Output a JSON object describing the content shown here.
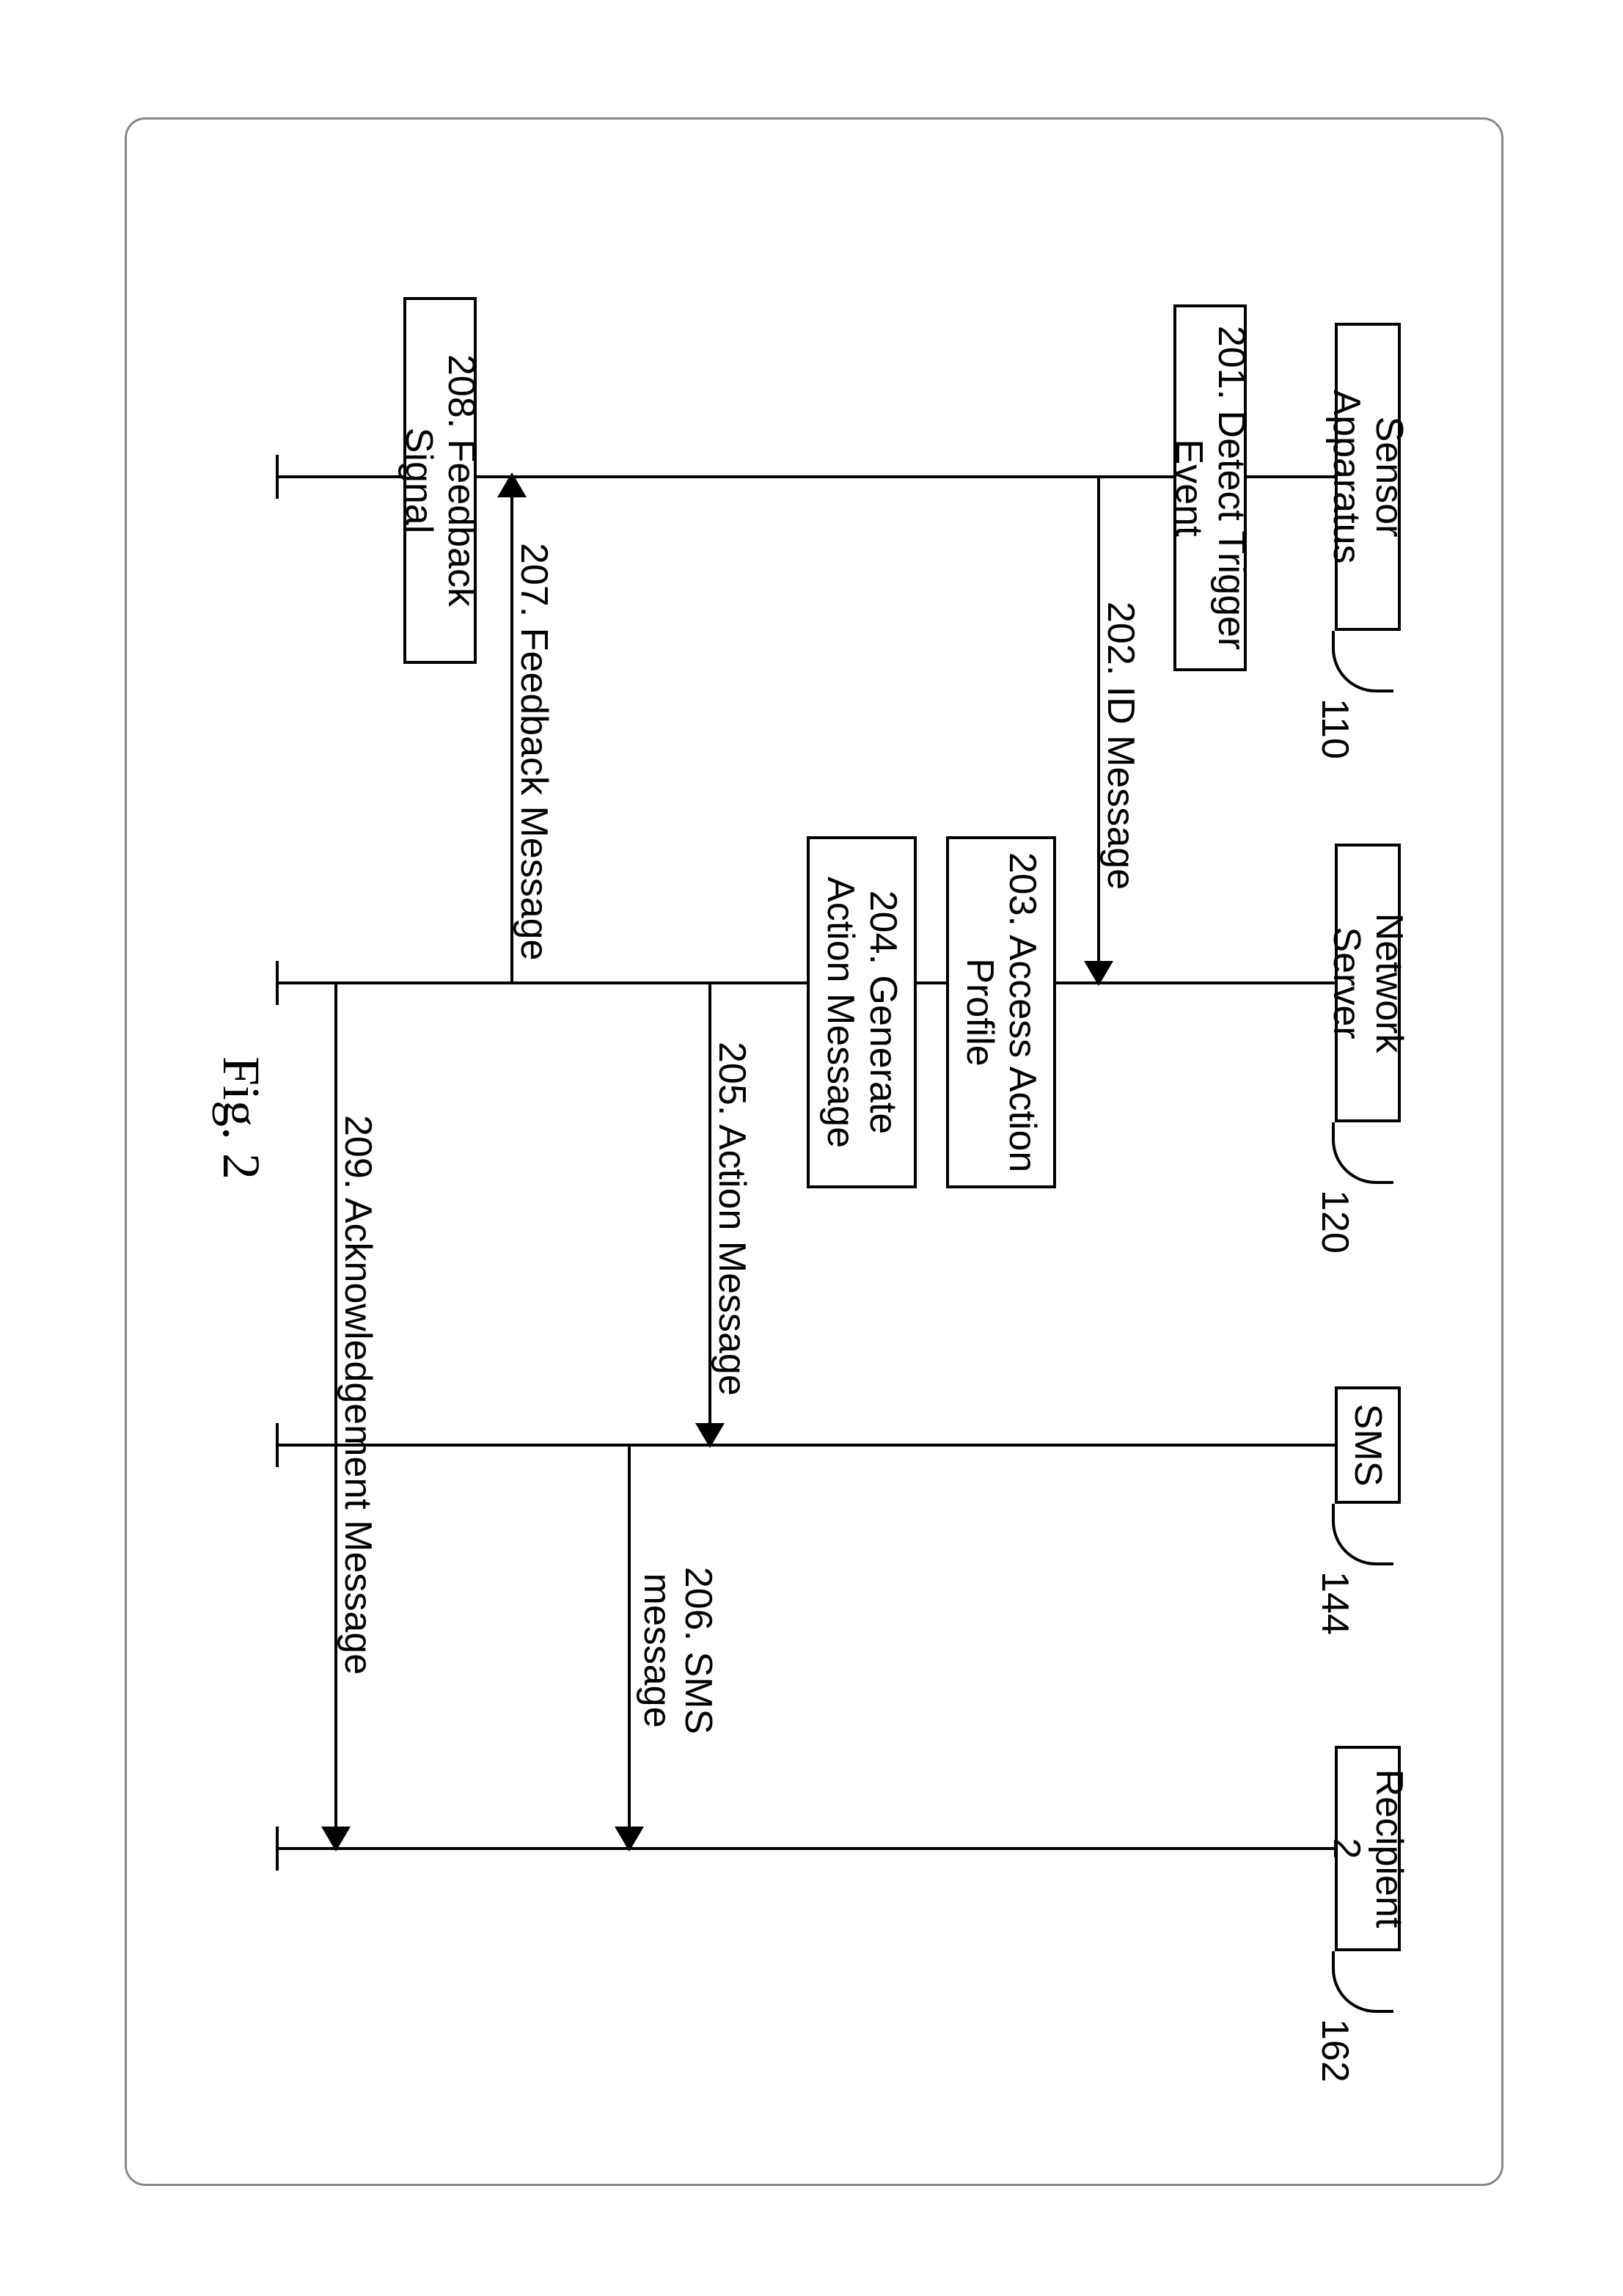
{
  "figure": {
    "caption": "Fig. 2"
  },
  "participants": {
    "sensor": {
      "label": "Sensor Apparatus",
      "ref": "110"
    },
    "server": {
      "label": "Network Server",
      "ref": "120"
    },
    "sms": {
      "label": "SMS",
      "ref": "144"
    },
    "recipient": {
      "label": "Recipient 2",
      "ref": "162"
    }
  },
  "steps": {
    "s201": "201. Detect Trigger Event",
    "s202": "202. ID Message",
    "s203": "203. Access Action Profile",
    "s204": "204. Generate Action Message",
    "s205": "205. Action Message",
    "s206": "206. SMS message",
    "s207": "207. Feedback Message",
    "s208": "208. Feedback Signal",
    "s209": "209. Acknowledgement Message"
  }
}
